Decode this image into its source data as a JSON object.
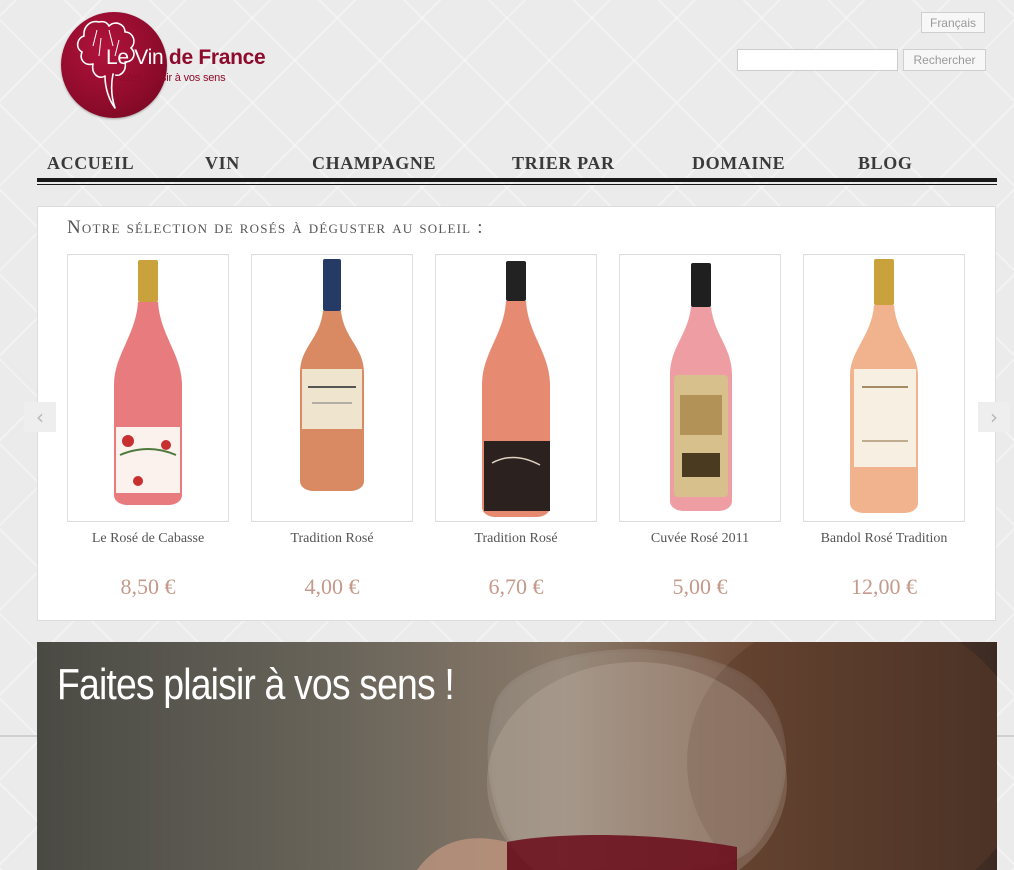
{
  "header": {
    "logo_word1": "Le Vin",
    "logo_word2": "de France",
    "logo_tagline": "Faites plaisir à vos sens",
    "language_label": "Français",
    "search": {
      "value": "",
      "button_label": "Rechercher"
    }
  },
  "nav": {
    "items": [
      {
        "label": "ACCUEIL"
      },
      {
        "label": "VIN"
      },
      {
        "label": "CHAMPAGNE"
      },
      {
        "label": "TRIER PAR"
      },
      {
        "label": "DOMAINE"
      },
      {
        "label": "BLOG"
      }
    ]
  },
  "selection": {
    "title": "Notre sélection de rosés à déguster au soleil :",
    "products": [
      {
        "name": "Le Rosé de Cabasse",
        "price": "8,50 €"
      },
      {
        "name": "Tradition Rosé",
        "price": "4,00 €"
      },
      {
        "name": "Tradition Rosé",
        "price": "6,70 €"
      },
      {
        "name": "Cuvée Rosé 2011",
        "price": "5,00 €"
      },
      {
        "name": "Bandol Rosé Tradition",
        "price": "12,00 €"
      }
    ]
  },
  "banner": {
    "text": "Faites plaisir à vos sens !"
  },
  "colors": {
    "brand": "#8e0b2b",
    "price": "#c49a8c",
    "nav_text": "#3a3a3a"
  }
}
